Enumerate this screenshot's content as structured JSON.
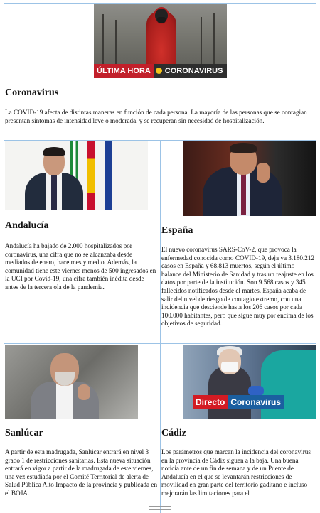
{
  "top": {
    "banner_left": "ÚLTIMA HORA",
    "banner_right": "CORONAVIRUS",
    "title": "Coronavirus",
    "body": "La COVID-19 afecta de distintas maneras en función de cada persona. La mayoría de las personas que se contagian presentan síntomas de intensidad leve o moderada, y se recuperan sin necesidad de hospitalización."
  },
  "cards": [
    {
      "title": "Andalucía",
      "body": "Andalucía ha bajado de 2.000 hospitalizados por coronavirus, una cifra que no se alcanzaba desde mediados de enero, hace mes y medio. Además, la comunidad tiene este viernes menos de 500 ingresados en la UCI por Covid-19, una cifra también inédita desde antes de la tercera ola de la pandemia."
    },
    {
      "title": "España",
      "body": "El nuevo coronavirus SARS-CoV-2, que provoca la enfermedad conocida como COVID-19, deja ya 3.180.212 casos en España y 68.813 muertos, según el último balance del Ministerio de Sanidad y tras un reajuste en los datos por parte de la institución. Son 9.568 casos y 345 fallecidos notificados desde el martes. España acaba de salir del nivel de riesgo de contagio extremo, con una incidencia que desciende hasta los 206 casos por cada 100.000 habitantes, pero que sigue muy por encima de los objetivos de seguridad."
    },
    {
      "title": "Sanlúcar",
      "body": "A partir de esta madrugada, Sanlúcar entrará en nivel 3 grado 1 de restricciones sanitarias. Esta nueva situación entrará en vigor a partir de la madrugada de este viernes, una vez estudiada por el Comité Territorial de alerta de Salud Pública Alto Impacto de la provincia y publicada en el BOJA."
    },
    {
      "title": "Cádiz",
      "body": "Los parámetros que marcan la incidencia del coronavirus en la provincia de Cádiz siguen a la baja. Una buena noticia ante de un fin de semana y de un Puente de Andalucía en el que se levantarán restricciones de movilidad en gran parte del territorio gaditano e incluso mejorarán las limitaciones para el",
      "badge_left": "Directo",
      "badge_right": "Coronavirus"
    }
  ],
  "colors": {
    "border": "#9cc3e6",
    "badge_red": "#d31b23",
    "badge_blue": "#1b5fa0"
  }
}
